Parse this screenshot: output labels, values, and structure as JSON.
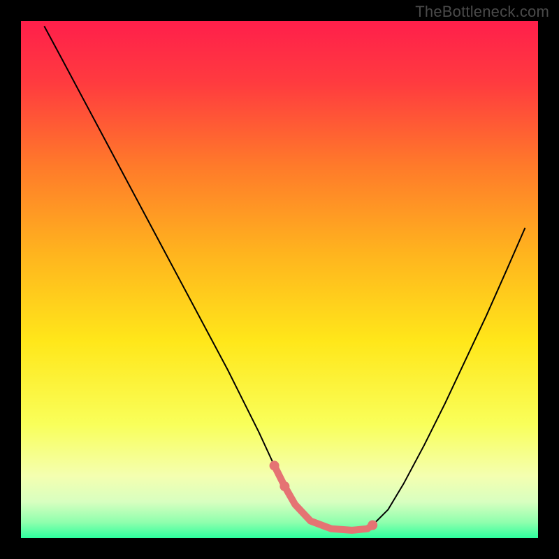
{
  "watermark": "TheBottleneck.com",
  "chart_data": {
    "type": "line",
    "title": "",
    "xlabel": "",
    "ylabel": "",
    "xlim": [
      0,
      100
    ],
    "ylim": [
      0,
      100
    ],
    "grid": false,
    "background": {
      "type": "vertical-gradient",
      "stops": [
        {
          "offset": 0.0,
          "color": "#ff1f4b"
        },
        {
          "offset": 0.12,
          "color": "#ff3b3f"
        },
        {
          "offset": 0.28,
          "color": "#ff7a2a"
        },
        {
          "offset": 0.45,
          "color": "#ffb41e"
        },
        {
          "offset": 0.62,
          "color": "#ffe71a"
        },
        {
          "offset": 0.78,
          "color": "#f9ff5a"
        },
        {
          "offset": 0.88,
          "color": "#f4ffb0"
        },
        {
          "offset": 0.93,
          "color": "#d8ffc0"
        },
        {
          "offset": 0.97,
          "color": "#8effad"
        },
        {
          "offset": 1.0,
          "color": "#2dff9e"
        }
      ]
    },
    "series": [
      {
        "name": "bottleneck-curve",
        "stroke": "#000000",
        "stroke_width": 2,
        "x": [
          4.5,
          8,
          12,
          16,
          20,
          24,
          28,
          32,
          36,
          40,
          43,
          46,
          49,
          51,
          53,
          56,
          60,
          64,
          67,
          68,
          71,
          74,
          78,
          82,
          86,
          90,
          94,
          97.5
        ],
        "y": [
          99,
          92.5,
          85,
          77.5,
          70,
          62.5,
          55,
          47.5,
          40,
          32.5,
          26.5,
          20.5,
          14,
          10,
          6.5,
          3.3,
          1.8,
          1.5,
          1.8,
          2.5,
          5.5,
          10.5,
          18,
          26,
          34.5,
          43,
          52,
          60
        ]
      },
      {
        "name": "optimal-highlight",
        "stroke": "#e57373",
        "stroke_width": 10,
        "linecap": "round",
        "x": [
          49,
          51,
          53,
          56,
          60,
          64,
          67,
          68
        ],
        "y": [
          14,
          10,
          6.5,
          3.3,
          1.8,
          1.5,
          1.8,
          2.5
        ],
        "dots": [
          {
            "x": 49,
            "y": 14
          },
          {
            "x": 51,
            "y": 10
          },
          {
            "x": 68,
            "y": 2.5
          }
        ]
      }
    ]
  }
}
